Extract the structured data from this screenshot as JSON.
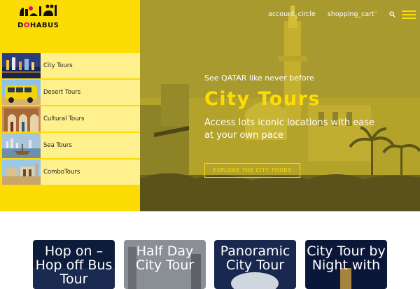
{
  "brand": {
    "logo_text_prefix": "D",
    "logo_text_o": "O",
    "logo_text_suffix": "HABUS",
    "arabic_mark": "الدوحة"
  },
  "nav": {
    "account": "account_circle",
    "cart": "shopping_cart",
    "cart_count": "0",
    "search_icon": "search-icon",
    "menu_icon": "hamburger-menu-icon"
  },
  "sidebar": {
    "items": [
      {
        "label": "City Tours"
      },
      {
        "label": "Desert Tours"
      },
      {
        "label": "Cultural Tours"
      },
      {
        "label": "Sea Tours"
      },
      {
        "label": "ComboTours"
      }
    ]
  },
  "hero": {
    "tagline": "See QATAR like never before",
    "title": "City Tours",
    "description": "Access lots iconic locations with ease at your own pace",
    "button": "EXPLORE THE CITY TOURS"
  },
  "cards": [
    {
      "title": "Hop on – Hop off Bus Tour"
    },
    {
      "title": "Half Day City Tour"
    },
    {
      "title": "Panoramic City Tour"
    },
    {
      "title": "City Tour by Night with"
    }
  ],
  "colors": {
    "brand_yellow": "#fddc05",
    "light_yellow": "#fef08d",
    "hero_overlay": "#b2a125",
    "accent_pink": "#e6007e"
  }
}
